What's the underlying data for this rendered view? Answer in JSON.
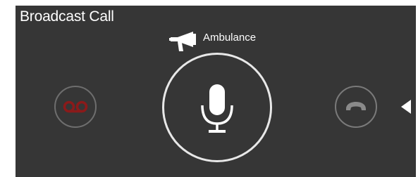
{
  "window": {
    "title": "Broadcast Call"
  },
  "channel": {
    "icon": "megaphone-icon",
    "name": "Ambulance"
  },
  "controls": {
    "voicemail_icon": "voicemail-icon",
    "mic_icon": "microphone-icon",
    "hangup_icon": "phone-hangup-icon",
    "expand_icon": "triangle-left-icon"
  },
  "colors": {
    "panel_background": "#363636",
    "voicemail_accent": "#8b1a1a",
    "ring_light": "#e8e8e8",
    "ring_dim": "#6e6e6e",
    "text": "#ffffff"
  }
}
